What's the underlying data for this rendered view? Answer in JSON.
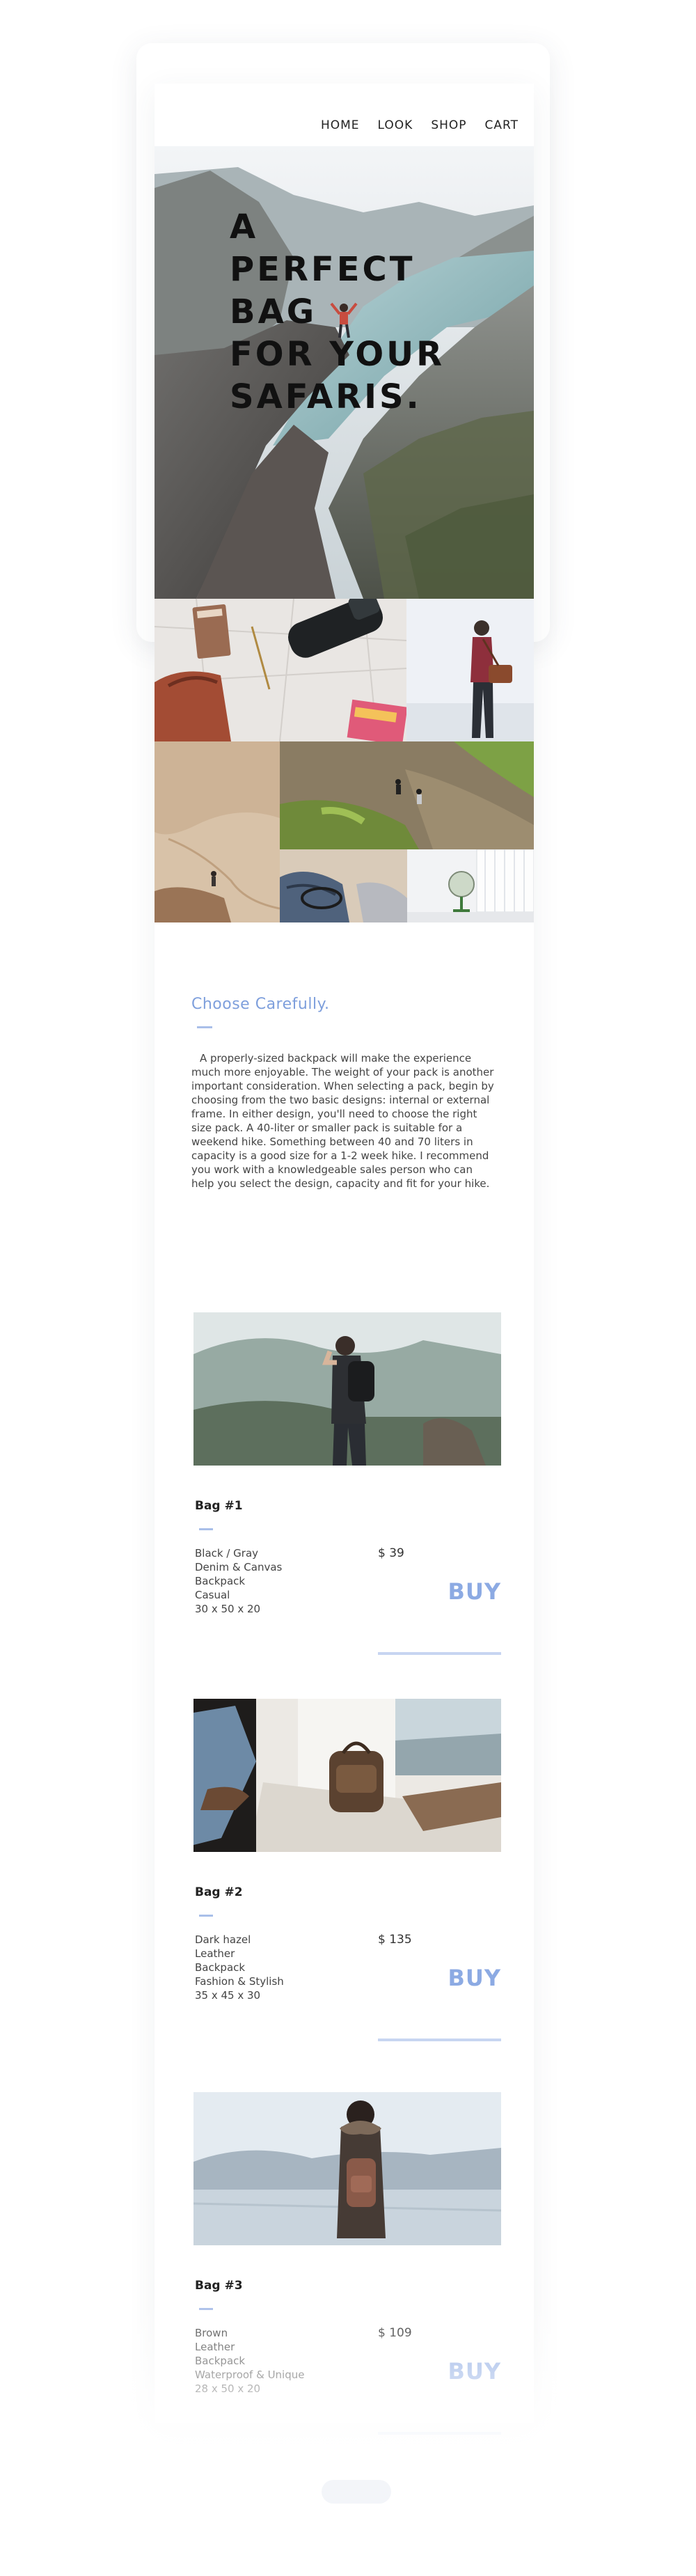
{
  "nav": {
    "items": [
      "HOME",
      "LOOK",
      "SHOP",
      "CART"
    ]
  },
  "hero": {
    "title": "A\nPERFECT\nBAG\nFOR YOUR\nSAFARIS."
  },
  "collage": {
    "tiles": [
      {
        "icon": "map-with-travel-gear-photo"
      },
      {
        "icon": "hiker-with-bag-photo"
      },
      {
        "icon": "desert-hiker-photo"
      },
      {
        "icon": "green-hillside-hikers-photo"
      },
      {
        "icon": "shoes-and-bag-photo"
      },
      {
        "icon": "globe-by-window-photo"
      }
    ]
  },
  "intro": {
    "heading": "Choose Carefully.",
    "text": "A properly-sized backpack will make the experience much more enjoyable. The weight of your pack is another important consideration. When selecting a pack, begin by choosing from the two basic designs: internal or external frame. In either design, you'll need to choose the right size pack. A 40-liter or smaller pack is suitable for a weekend hike. Something between 40 and 70 liters in capacity is a good size for a 1-2 week hike. I recommend you work with a knowledgeable sales person who can help you select the design, capacity and fit for your hike."
  },
  "products": [
    {
      "name": "Bag #1",
      "specs": [
        "Black / Gray",
        "Denim & Canvas",
        "Backpack",
        "Casual",
        "30 x 50 x 20"
      ],
      "price": "$ 39",
      "buy_label": "BUY",
      "photo_icon": "photographer-with-backpack-photo"
    },
    {
      "name": "Bag #2",
      "specs": [
        "Dark hazel",
        "Leather",
        "Backpack",
        "Fashion & Stylish",
        "35 x 45 x 30"
      ],
      "price": "$ 135",
      "buy_label": "BUY",
      "photo_icon": "leather-backpack-on-boat-photo"
    },
    {
      "name": "Bag #3",
      "specs": [
        "Brown",
        "Leather",
        "Backpack",
        "Waterproof & Unique",
        "28 x 50 x 20"
      ],
      "price": "$ 109",
      "buy_label": "BUY",
      "photo_icon": "woman-with-backpack-at-lake-photo"
    }
  ],
  "colors": {
    "accent": "#7e9fdc",
    "buy": "#8caae3",
    "underline": "#c7d5f1",
    "text": "#333333"
  }
}
